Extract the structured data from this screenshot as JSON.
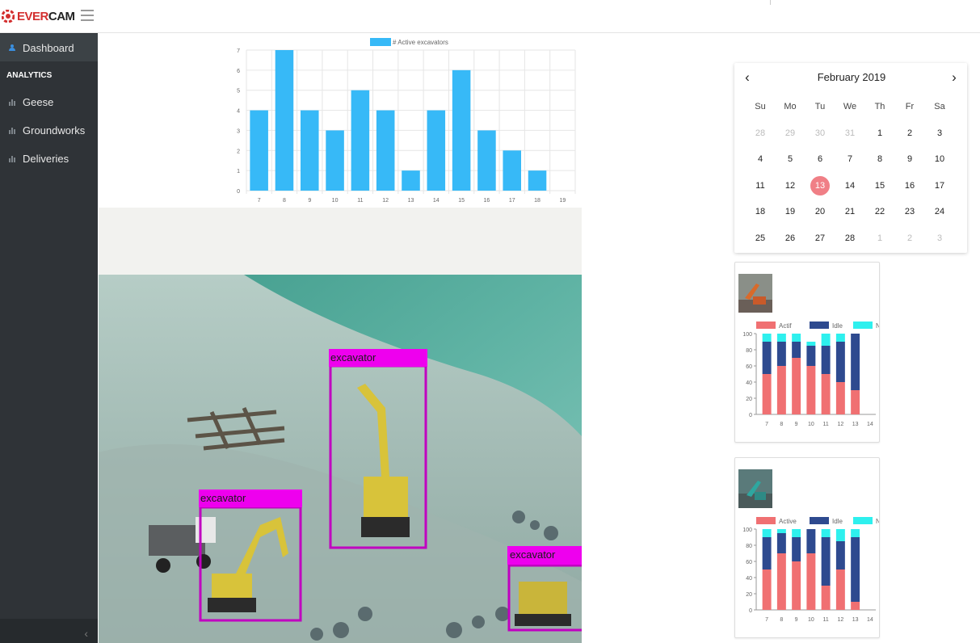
{
  "app": {
    "brand_prefix": "EVER",
    "brand_suffix": "CAM"
  },
  "sidebar": {
    "items": [
      {
        "label": "Dashboard",
        "icon": "dashboard-icon",
        "active": true
      },
      {
        "label": "Geese",
        "icon": "bar-chart-icon",
        "active": false
      },
      {
        "label": "Groundworks",
        "icon": "bar-chart-icon",
        "active": false
      },
      {
        "label": "Deliveries",
        "icon": "bar-chart-icon",
        "active": false
      }
    ],
    "section_label": "ANALYTICS",
    "collapse_icon": "chevron-left-icon"
  },
  "colors": {
    "bar": "#37b9f7",
    "active_red": "#f07072",
    "idle_blue": "#2e4a8f",
    "not_visible_cyan": "#2ef0ee",
    "today": "#f07f86"
  },
  "chart_data": [
    {
      "type": "bar",
      "legend": [
        "# Active excavators"
      ],
      "categories": [
        "7",
        "8",
        "9",
        "10",
        "11",
        "12",
        "13",
        "14",
        "15",
        "16",
        "17",
        "18",
        "19"
      ],
      "series": [
        {
          "name": "# Active excavators",
          "values": [
            4,
            7,
            4,
            3,
            5,
            4,
            1,
            4,
            6,
            3,
            2,
            1,
            0
          ]
        }
      ],
      "ylim": [
        0,
        7
      ],
      "yticks": [
        "0",
        "1",
        "2",
        "3",
        "4",
        "5",
        "6",
        "7"
      ]
    },
    {
      "type": "bar",
      "stacked": true,
      "categories": [
        "7",
        "8",
        "9",
        "10",
        "11",
        "12",
        "13",
        "14"
      ],
      "series": [
        {
          "name": "Actif",
          "values": [
            50,
            60,
            70,
            60,
            50,
            40,
            30,
            0
          ]
        },
        {
          "name": "Idle",
          "values": [
            40,
            30,
            20,
            25,
            35,
            50,
            70,
            0
          ]
        },
        {
          "name": "Not visible",
          "values": [
            10,
            10,
            10,
            5,
            15,
            10,
            0,
            0
          ]
        }
      ],
      "ylim": [
        0,
        100
      ],
      "yticks": [
        "0",
        "20",
        "40",
        "60",
        "80",
        "100"
      ]
    },
    {
      "type": "bar",
      "stacked": true,
      "categories": [
        "7",
        "8",
        "9",
        "10",
        "11",
        "12",
        "13",
        "14"
      ],
      "series": [
        {
          "name": "Active",
          "values": [
            50,
            70,
            60,
            70,
            30,
            50,
            10,
            0
          ]
        },
        {
          "name": "Idle",
          "values": [
            40,
            25,
            30,
            30,
            60,
            35,
            80,
            0
          ]
        },
        {
          "name": "Not visible",
          "values": [
            10,
            5,
            10,
            0,
            10,
            15,
            10,
            0
          ]
        }
      ],
      "ylim": [
        0,
        100
      ],
      "yticks": [
        "0",
        "20",
        "40",
        "60",
        "80",
        "100"
      ]
    }
  ],
  "calendar": {
    "title": "February 2019",
    "prev_icon": "chevron-left-icon",
    "next_icon": "chevron-right-icon",
    "weekdays": [
      "Su",
      "Mo",
      "Tu",
      "We",
      "Th",
      "Fr",
      "Sa"
    ],
    "weeks": [
      [
        "28",
        "29",
        "30",
        "31",
        "1",
        "2",
        "3"
      ],
      [
        "4",
        "5",
        "6",
        "7",
        "8",
        "9",
        "10"
      ],
      [
        "11",
        "12",
        "13",
        "14",
        "15",
        "16",
        "17"
      ],
      [
        "18",
        "19",
        "20",
        "21",
        "22",
        "23",
        "24"
      ],
      [
        "25",
        "26",
        "27",
        "28",
        "1",
        "2",
        "3"
      ]
    ],
    "other_month": [
      [
        0,
        0
      ],
      [
        0,
        1
      ],
      [
        0,
        2
      ],
      [
        0,
        3
      ],
      [
        4,
        4
      ],
      [
        4,
        5
      ],
      [
        4,
        6
      ]
    ],
    "selected": "13"
  },
  "camera": {
    "detections": [
      "excavator",
      "excavator",
      "excavator"
    ]
  }
}
